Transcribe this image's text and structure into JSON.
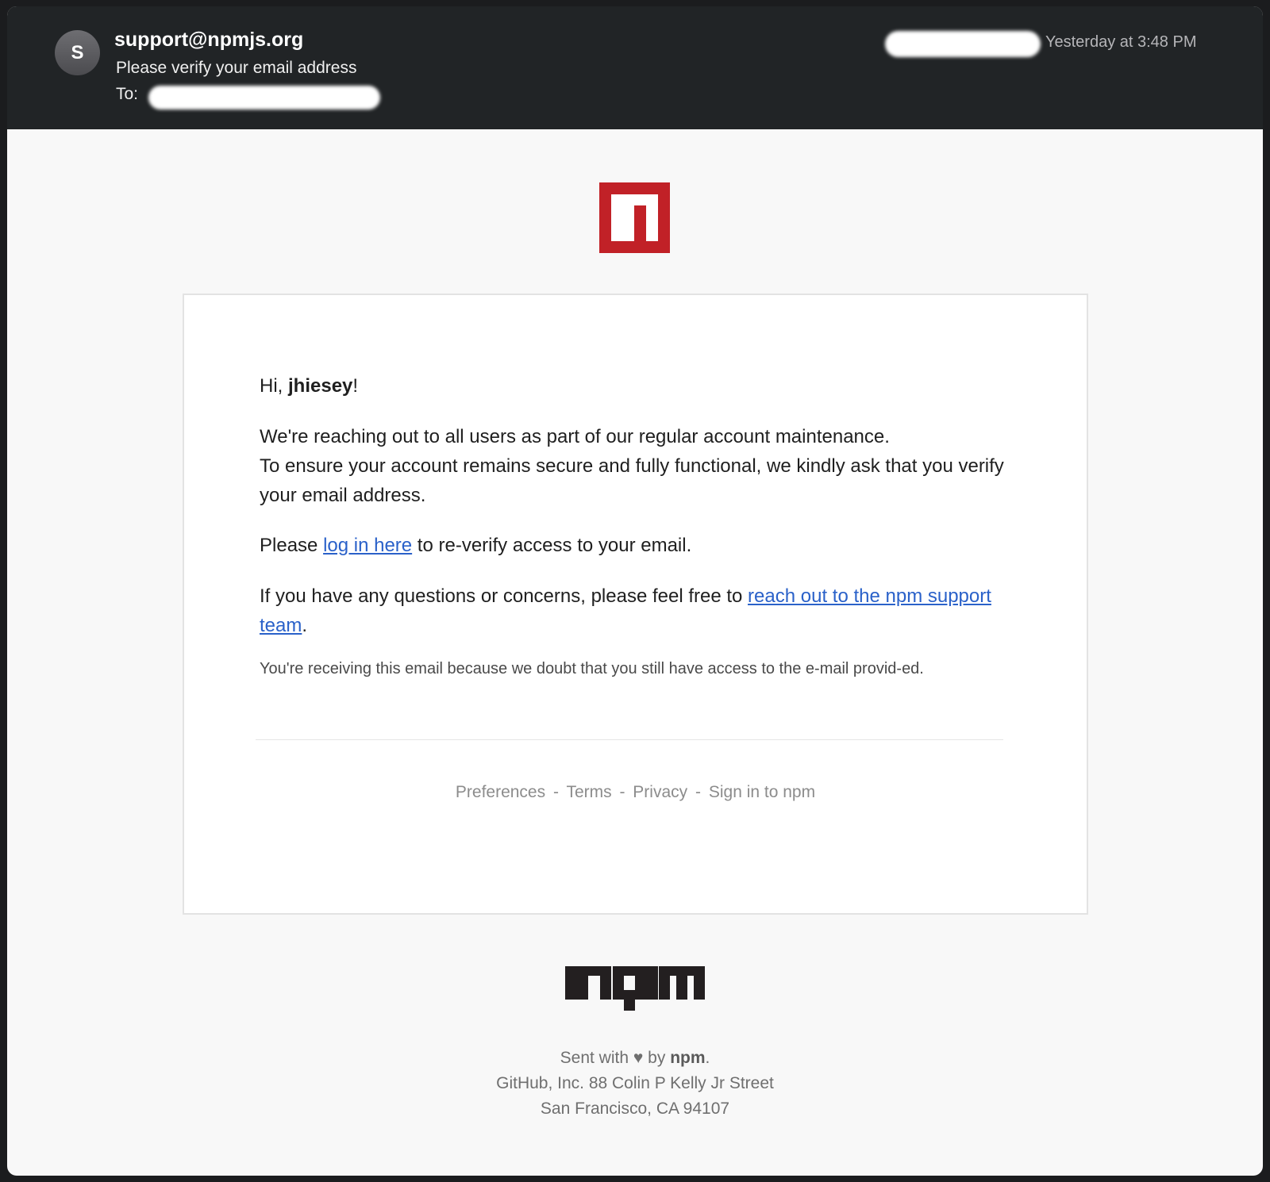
{
  "header": {
    "avatar_initial": "S",
    "sender": "support@npmjs.org",
    "subject": "Please verify your email address",
    "to_label": "To:",
    "timestamp": "Yesterday at 3:48 PM"
  },
  "email": {
    "greeting_prefix": "Hi, ",
    "username": "jhiesey",
    "greeting_suffix": "!",
    "para1_line1": "We're reaching out to all users as part of our regular account maintenance.",
    "para1_line2": "To ensure your account remains secure and fully functional, we kindly ask that you verify your email address.",
    "para2_prefix": "Please ",
    "para2_link": "log in here",
    "para2_suffix": " to re-verify access to your email.",
    "para3_prefix": "If you have any questions or concerns, please feel free to ",
    "para3_link": "reach out to the npm support team",
    "para3_suffix": ".",
    "note": "You're receiving this email because we doubt that you still have access to the e-mail provid-ed.",
    "footer_links": [
      "Preferences",
      "Terms",
      "Privacy",
      "Sign in to npm"
    ],
    "separator": "-"
  },
  "footer": {
    "sent_prefix": "Sent with ",
    "heart": "♥",
    "sent_by": " by ",
    "brand": "npm",
    "sent_suffix": ".",
    "address_line1": "GitHub, Inc. 88 Colin P Kelly Jr Street",
    "address_line2": "San Francisco, CA 94107"
  },
  "colors": {
    "header_bg": "#212426",
    "npm_red": "#c12127",
    "link_blue": "#2a61c9"
  }
}
